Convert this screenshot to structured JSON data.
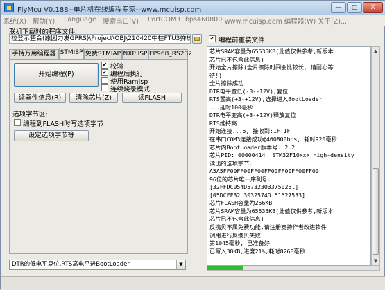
{
  "window": {
    "title": "FlyMcu V0.188--单片机在线编程专家--www.mcuisp.com",
    "minimize": "—",
    "maximize": "□",
    "close": "X"
  },
  "menu": {
    "items": [
      "系统(X)",
      "帮助(Y)",
      "Language",
      "搜索串口(V)",
      "PortCOM3",
      "bps460800",
      "www.mcuisp.com 编程器(W)",
      "关于(Z)..."
    ]
  },
  "file_section": {
    "label": "联机下载时的程序文件:",
    "path": "拉登示整合(原因力发GPRS)\\Project\\OBJ\\210420中柱FTU3弹操.hex",
    "browse_icon": "folder-icon",
    "verify_checkbox": {
      "label": "编程前重装文件",
      "checked": true
    }
  },
  "tabs": [
    "手持万用编程器",
    "STMISP",
    "免费STMIAP",
    "NXP ISP",
    "EP968_RS232"
  ],
  "active_tab": 1,
  "stmisp": {
    "start_button": "开始编程(P)",
    "options": [
      {
        "label": "校验",
        "checked": true
      },
      {
        "label": "编程后执行",
        "checked": true
      },
      {
        "label": "使用RamIsp",
        "checked": false
      },
      {
        "label": "连续烧录模式",
        "checked": false
      }
    ],
    "read_info_button": "读器件信息(R)",
    "erase_button": "清除芯片(Z)",
    "read_flash_button": "读FLASH",
    "option_bytes_label": "选项字节区:",
    "write_option_checkbox": {
      "label": "编程到FLASH时写选项字节",
      "checked": false
    },
    "set_option_button": "设定选项字节等"
  },
  "log": {
    "lines": [
      "芯片SRAM容量为65535KB(此值仅供参考,新版本",
      "芯片已不包含此信息)",
      "开始全片擦除(全片擦除时间会比较长, 请耐心等",
      "待!)",
      "全片擦除成功",
      "DTR电平置低(-3--12V),复位",
      "RTS置高(+3-+12V),选择进入BootLoader",
      "...延时100毫秒",
      "DTR电平变高(+3-+12V)释放复位",
      "RTS维持高",
      "开始连接...5, 接收到:1F 1F",
      "在串口COM3连接成功@460800bps, 耗时920毫秒",
      "芯片内BootLoader版本号: 2.2",
      "芯片PID: 00000414  STM32F10xxx_High-density",
      "读出的选项字节:",
      "A5A5FF00FF00FF00FF00FF00FF00FF00",
      "96位的芯片唯一序列号:",
      "[32FFDC054D5732303375025l]",
      "[05DCFF32 3032574D 51627533]",
      "芯片FLASH容量为256KB",
      "芯片SRAM容量为65535KB(此值仅供参考,新版本",
      "芯片已不包含此信息)",
      "反携贝不属免费功能,请注册支持作者改进软件",
      "调用进行反携贝失败",
      "第1045毫秒, 已准备好",
      "已写入38KB,进度21%,耗时8268毫秒"
    ]
  },
  "progress": {
    "percent": 21
  },
  "reset_mode": {
    "selected": "DTR的低电平复位,RTS高电平进BootLoader"
  },
  "colors": {
    "progress_fill": "#2ebd2e",
    "title_bar": "#b3cbe6"
  }
}
